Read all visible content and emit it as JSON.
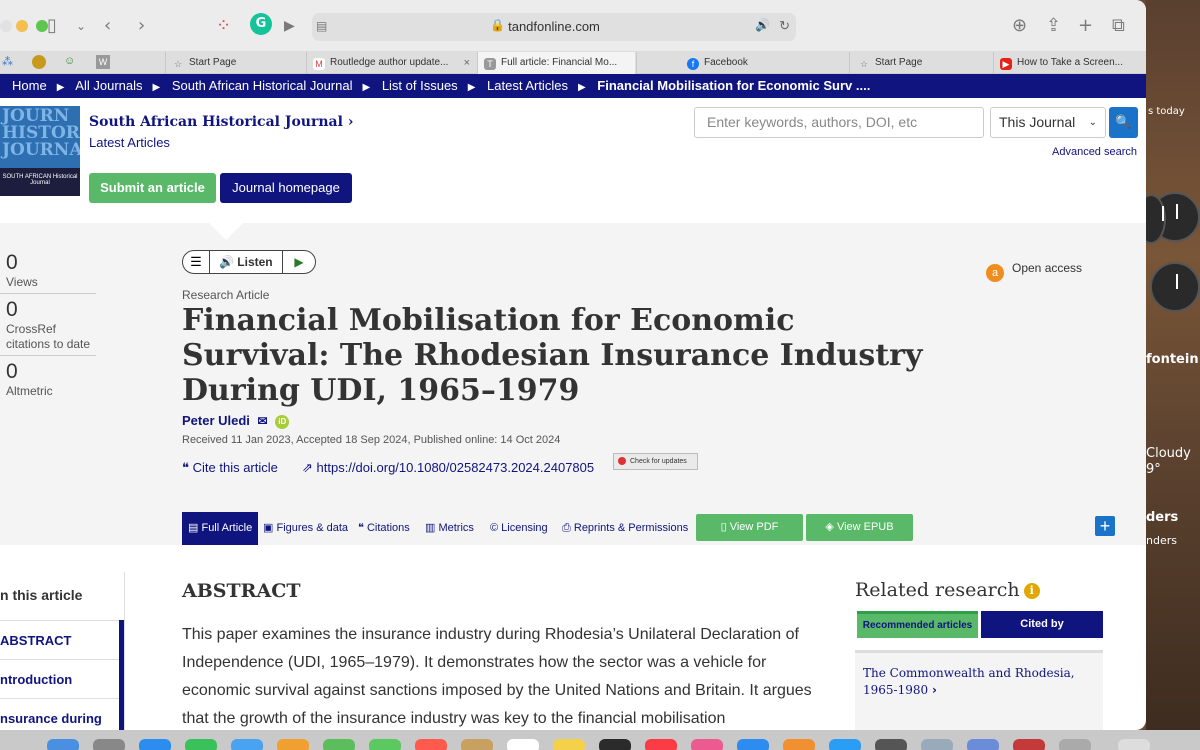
{
  "browser": {
    "url": "tandfonline.com",
    "tabs": [
      {
        "label": "Start Page",
        "icon": "star-icon"
      },
      {
        "label": "Routledge author update...",
        "icon": "gmail-icon"
      },
      {
        "label": "Full article: Financial Mo...",
        "icon": "tf-icon"
      },
      {
        "label": "Facebook",
        "icon": "facebook-icon"
      },
      {
        "label": "Start Page",
        "icon": "star-icon"
      },
      {
        "label": "How to Take a Screen...",
        "icon": "youtube-icon"
      }
    ]
  },
  "breadcrumb": [
    "Home",
    "All Journals",
    "South African Historical Journal",
    "List of Issues",
    "Latest Articles",
    "Financial Mobilisation for Economic Surv ...."
  ],
  "journal": {
    "title": "South African Historical Journal",
    "subtitle": "Latest Articles",
    "submit_label": "Submit an article",
    "homepage_label": "Journal homepage",
    "cover_big": "JOURN HISTORI JOURNAL",
    "cover_band": "SOUTH AFRICAN Historical Journal"
  },
  "search": {
    "placeholder": "Enter keywords, authors, DOI, etc",
    "scope": "This Journal",
    "advanced_label": "Advanced search"
  },
  "metrics": [
    {
      "value": "0",
      "label": "Views"
    },
    {
      "value": "0",
      "label": "CrossRef citations to date"
    },
    {
      "value": "0",
      "label": "Altmetric"
    }
  ],
  "player": {
    "listen_label": "Listen"
  },
  "article": {
    "type": "Research Article",
    "title": "Financial Mobilisation for Economic Survival: The Rhodesian Insurance Industry During UDI, 1965–1979",
    "author": "Peter Uledi",
    "dates": "Received 11 Jan 2023, Accepted 18 Sep 2024, Published online: 14 Oct 2024",
    "cite_label": "Cite this article",
    "doi": "https://doi.org/10.1080/02582473.2024.2407805",
    "check_label": "Check for updates",
    "open_access": "Open access"
  },
  "article_tabs": [
    "Full Article",
    "Figures & data",
    "Citations",
    "Metrics",
    "Licensing",
    "Reprints & Permissions"
  ],
  "pdf_label": "View PDF",
  "epub_label": "View EPUB",
  "toc": {
    "heading": "n this article",
    "items": [
      "ABSTRACT",
      "ntroduction",
      "nsurance during"
    ]
  },
  "abstract": {
    "heading": "ABSTRACT",
    "text": "This paper examines the insurance industry during Rhodesia’s Unilateral Declaration of Independence (UDI, 1965–1979). It demonstrates how the sector was a vehicle for economic survival against sanctions imposed by the United Nations and Britain. It argues that the growth of the insurance industry was key to the financial mobilisation"
  },
  "related": {
    "heading": "Related research",
    "tab_recommended": "Recommended articles",
    "tab_cited": "Cited by",
    "first_title": "The Commonwealth and Rhodesia, 1965-1980"
  },
  "desktop": {
    "today": "s today",
    "city": "fontein",
    "weather": "Cloudy",
    "temp": "9°",
    "reminders1": "ders",
    "reminders2": "nders"
  }
}
